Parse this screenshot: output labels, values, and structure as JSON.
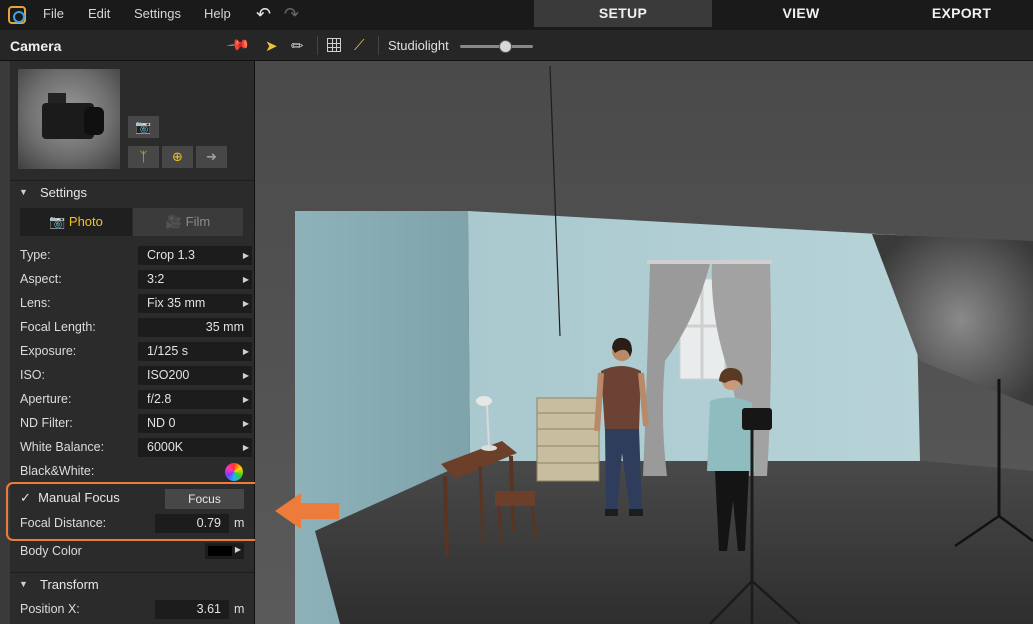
{
  "menu": {
    "file": "File",
    "edit": "Edit",
    "settings": "Settings",
    "help": "Help"
  },
  "modes": {
    "setup": "SETUP",
    "view": "VIEW",
    "export": "EXPORT",
    "active": "SETUP"
  },
  "toolbar": {
    "studiolight_label": "Studiolight",
    "studiolight_level": 0.62
  },
  "panel": {
    "title": "Camera",
    "section_settings": "Settings",
    "tab_photo": "Photo",
    "tab_film": "Film",
    "rows": {
      "type": {
        "label": "Type:",
        "value": "Crop 1.3"
      },
      "aspect": {
        "label": "Aspect:",
        "value": "3:2"
      },
      "lens": {
        "label": "Lens:",
        "value": "Fix 35 mm"
      },
      "focal_length": {
        "label": "Focal Length:",
        "value": "35 mm"
      },
      "exposure": {
        "label": "Exposure:",
        "value": "1/125 s"
      },
      "iso": {
        "label": "ISO:",
        "value": "ISO200"
      },
      "aperture": {
        "label": "Aperture:",
        "value": "f/2.8"
      },
      "nd_filter": {
        "label": "ND Filter:",
        "value": "ND 0"
      },
      "white_balance": {
        "label": "White Balance:",
        "value": "6000K"
      },
      "black_white": {
        "label": "Black&White:"
      }
    },
    "manual_focus": {
      "label": "Manual Focus",
      "checked": true,
      "button": "Focus"
    },
    "focal_distance": {
      "label": "Focal Distance:",
      "value": "0.79",
      "unit": "m"
    },
    "body_color": {
      "label": "Body Color",
      "color": "#000000"
    },
    "section_transform": "Transform",
    "position_x": {
      "label": "Position X:",
      "value": "3.61",
      "unit": "m"
    }
  },
  "colors": {
    "accent": "#f3c221",
    "highlight": "#ec7b3c",
    "wall": "#8fb1b8"
  }
}
